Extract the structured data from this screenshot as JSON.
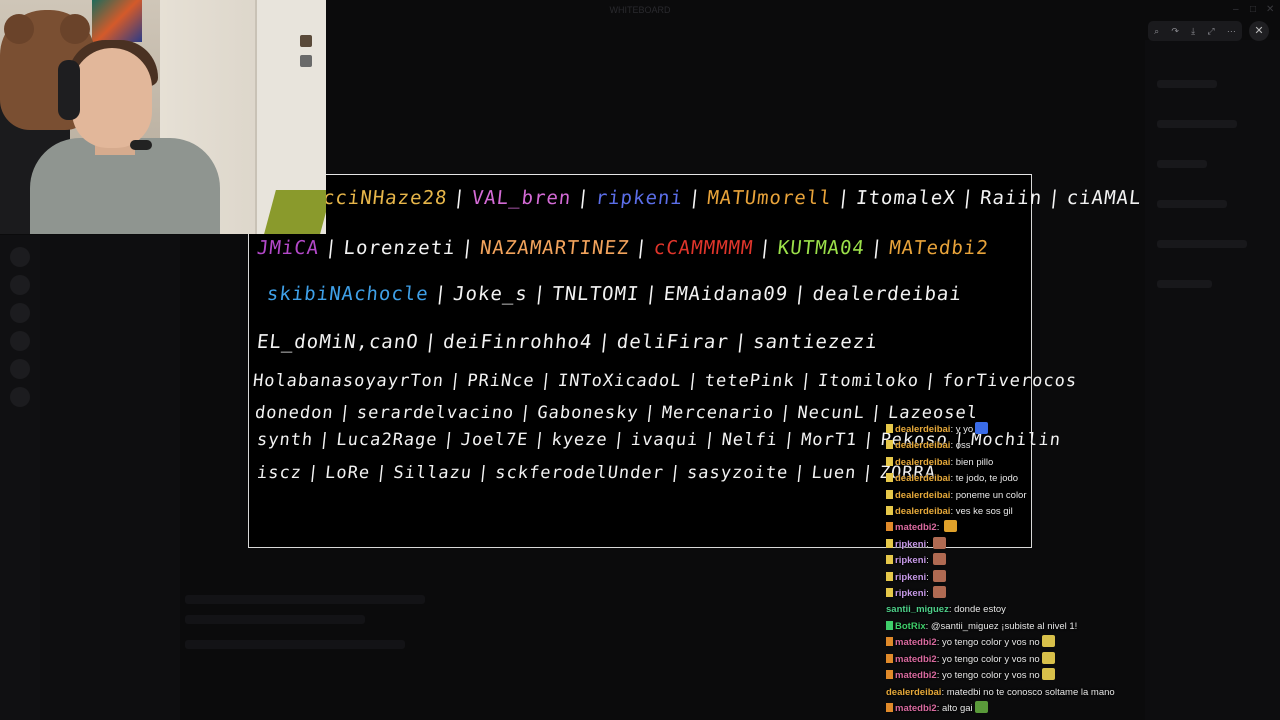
{
  "window": {
    "title": "WHITEBOARD",
    "controls": [
      "–",
      "□",
      "✕"
    ]
  },
  "viewer_toolbar": {
    "icons": [
      "zoom-icon",
      "redo-icon",
      "download-icon",
      "expand-icon",
      "more-icon"
    ],
    "glyphs": [
      "⌕",
      "↷",
      "⤓",
      "⤢",
      "⋯"
    ],
    "close": "✕"
  },
  "whiteboard": {
    "lines": [
      [
        "cciNHaze28",
        "VAL_bren",
        "ripkeni",
        "MATUmorell",
        "ItomaleX",
        "Raiin",
        "ciAMAL"
      ],
      [
        "JMiCA",
        "Lorenzeti",
        "NAZAMARTINEZ",
        "cCAMMMMM",
        "KUTMA04",
        "MATedbi2"
      ],
      [
        "skibiNAchocle",
        "Joke_s",
        "TNLTOMI",
        "EMAidana09",
        "dealerdeibai"
      ],
      [
        "EL_doMiN,canO",
        "deiFinrohho4",
        "deliFirar",
        "santiezezi"
      ],
      [
        "HolabanasoyayrTon",
        "PRiNce",
        "INToXicadoL",
        "tetePink",
        "Itomiloko",
        "forTiverocos"
      ],
      [
        "donedon",
        "serardelvacino",
        "Gabonesky",
        "Mercenario",
        "NecunL",
        "Lazeosel"
      ],
      [
        "synth",
        "Luca2Rage",
        "Joel7E",
        "kyeze",
        "ivaqui",
        "Nelfi",
        "MorT1",
        "Pekoso",
        "Mochilin"
      ],
      [
        "iscz",
        "LoRe",
        "Sillazu",
        "sckferodelUnder",
        "sasyzoite",
        "Luen",
        "ZORRA"
      ]
    ],
    "line_colors": [
      [
        "#e7b64a",
        "#d46bd6",
        "#5b6ee8",
        "#e8a33a",
        "#f2f2f2",
        "#f2f2f2",
        "#f2f2f2"
      ],
      [
        "#b348c9",
        "#f2f2f2",
        "#f2a35c",
        "#e0352b",
        "#9be04a",
        "#e8a33a"
      ],
      [
        "#3fa0e8",
        "#f2f2f2",
        "#f2f2f2",
        "#f2f2f2",
        "#f2f2f2"
      ],
      [
        "#f2f2f2",
        "#f2f2f2",
        "#f2f2f2",
        "#f2f2f2"
      ],
      [
        "#f2f2f2",
        "#f2f2f2",
        "#f2f2f2",
        "#f2f2f2",
        "#f2f2f2",
        "#f2f2f2"
      ],
      [
        "#f2f2f2",
        "#f2f2f2",
        "#f2f2f2",
        "#f2f2f2",
        "#f2f2f2",
        "#f2f2f2"
      ],
      [
        "#f2f2f2",
        "#f2f2f2",
        "#f2f2f2",
        "#f2f2f2",
        "#f2f2f2",
        "#f2f2f2",
        "#f2f2f2",
        "#f2f2f2",
        "#f2f2f2"
      ],
      [
        "#f2f2f2",
        "#f2f2f2",
        "#f2f2f2",
        "#f2f2f2",
        "#f2f2f2",
        "#f2f2f2",
        "#f2f2f2"
      ]
    ]
  },
  "chat": {
    "messages": [
      {
        "user": "dealerdeibai",
        "color": "#e6a93a",
        "text": "y yo",
        "badge": "mod",
        "emote": "#3a6ce8"
      },
      {
        "user": "dealerdeibai",
        "color": "#e6a93a",
        "text": "oss",
        "badge": "mod",
        "emote": ""
      },
      {
        "user": "dealerdeibai",
        "color": "#e6a93a",
        "text": "bien pillo",
        "badge": "mod",
        "emote": ""
      },
      {
        "user": "dealerdeibai",
        "color": "#e6a93a",
        "text": "te jodo, te jodo",
        "badge": "mod",
        "emote": ""
      },
      {
        "user": "dealerdeibai",
        "color": "#e6a93a",
        "text": "poneme un color",
        "badge": "mod",
        "emote": ""
      },
      {
        "user": "dealerdeibai",
        "color": "#e6a93a",
        "text": "ves ke sos gil",
        "badge": "mod",
        "emote": ""
      },
      {
        "user": "matedbi2",
        "color": "#d96a9f",
        "text": "",
        "badge": "sub",
        "emote": "#e0a12a"
      },
      {
        "user": "ripkeni",
        "color": "#c79ae8",
        "text": "",
        "badge": "mod",
        "emote": "#b06a52"
      },
      {
        "user": "ripkeni",
        "color": "#c79ae8",
        "text": "",
        "badge": "mod",
        "emote": "#b06a52"
      },
      {
        "user": "ripkeni",
        "color": "#c79ae8",
        "text": "",
        "badge": "mod",
        "emote": "#b06a52"
      },
      {
        "user": "ripkeni",
        "color": "#c79ae8",
        "text": "",
        "badge": "mod",
        "emote": "#b06a52"
      },
      {
        "user": "santii_miguez",
        "color": "#4fd08a",
        "text": "donde estoy",
        "badge": "",
        "emote": ""
      },
      {
        "user": "BotRix",
        "color": "#3fce6a",
        "text": "@santii_miguez ¡subiste al nivel 1!",
        "badge": "bot",
        "emote": ""
      },
      {
        "user": "matedbi2",
        "color": "#d96a9f",
        "text": "yo tengo color y vos no",
        "badge": "sub",
        "emote": "#d8c04a"
      },
      {
        "user": "matedbi2",
        "color": "#d96a9f",
        "text": "yo tengo color y vos no",
        "badge": "sub",
        "emote": "#d8c04a"
      },
      {
        "user": "matedbi2",
        "color": "#d96a9f",
        "text": "yo tengo color y vos no",
        "badge": "sub",
        "emote": "#d8c04a"
      },
      {
        "user": "dealerdeibai",
        "color": "#e6a93a",
        "text": "matedbi no te conosco soltame la mano",
        "badge": "",
        "emote": ""
      },
      {
        "user": "matedbi2",
        "color": "#d96a9f",
        "text": "alto gai",
        "badge": "sub",
        "emote": "#5a9a3a"
      }
    ]
  }
}
